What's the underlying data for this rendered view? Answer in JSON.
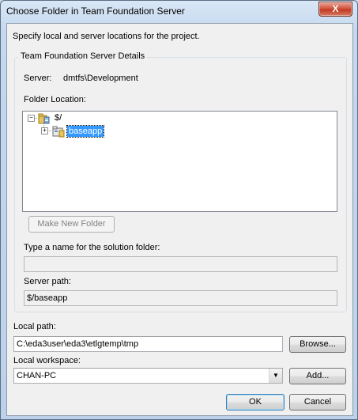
{
  "window": {
    "title": "Choose Folder in Team Foundation Server",
    "close_glyph": "X"
  },
  "intro_text": "Specify local and server locations for the project.",
  "group": {
    "title": "Team Foundation Server Details",
    "server_label": "Server:",
    "server_value": "dmtfs\\Development",
    "folder_location_label": "Folder Location:",
    "tree": {
      "root": {
        "label": "$/",
        "expander": "−",
        "icon": "server-folder-icon"
      },
      "child": {
        "label": "baseapp",
        "expander": "+",
        "icon": "project-folder-icon",
        "selected": true
      }
    },
    "make_new_folder_label": "Make New Folder",
    "solution_folder_label": "Type a name for the solution folder:",
    "solution_folder_value": "",
    "server_path_label": "Server path:",
    "server_path_value": "$/baseapp"
  },
  "local_path": {
    "label": "Local path:",
    "value": "C:\\eda3user\\eda3\\etlgtemp\\tmp",
    "browse_label": "Browse..."
  },
  "local_workspace": {
    "label": "Local workspace:",
    "value": "CHAN-PC",
    "add_label": "Add..."
  },
  "buttons": {
    "ok_label": "OK",
    "cancel_label": "Cancel"
  },
  "colors": {
    "selection": "#3399ff",
    "close_button": "#c13a22",
    "title_bar": "#c4d8ee"
  }
}
